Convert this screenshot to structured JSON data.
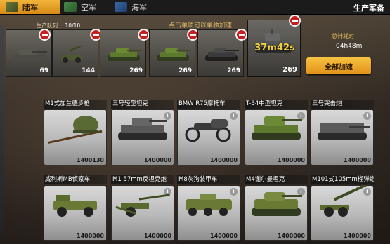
{
  "tabs": [
    {
      "label": "陆军",
      "active": true
    },
    {
      "label": "空军",
      "active": false
    },
    {
      "label": "海军",
      "active": false
    }
  ],
  "page_title": "生产军备",
  "queue": {
    "label": "生产队列:",
    "value": "10/10",
    "hint": "点击单项可以单独加速",
    "slots": [
      {
        "count": "69",
        "icon": "tank-destroyer-icon"
      },
      {
        "count": "144",
        "icon": "artillery-gun-icon"
      },
      {
        "count": "269",
        "icon": "green-tank-icon"
      },
      {
        "count": "269",
        "icon": "green-tank-icon"
      },
      {
        "count": "269",
        "icon": "dark-tank-icon"
      }
    ],
    "active": {
      "timer": "37m42s",
      "count": "269",
      "icon": "grey-tank-icon"
    },
    "total_label": "总计耗时",
    "total_value": "04h48m",
    "speedup_label": "全部加速"
  },
  "cards": [
    {
      "name": "M1式加兰德步枪",
      "cost": "1400130",
      "icon": "rifle-icon"
    },
    {
      "name": "三号轻型坦克",
      "cost": "1400000",
      "icon": "light-tank-icon"
    },
    {
      "name": "BMW R75摩托车",
      "cost": "1400000",
      "icon": "motorcycle-icon"
    },
    {
      "name": "T-34中型坦克",
      "cost": "1400000",
      "icon": "medium-tank-icon"
    },
    {
      "name": "三号突击炮",
      "cost": "1400000",
      "icon": "assault-gun-icon"
    },
    {
      "name": "威利斯MB侦察车",
      "cost": "1400000",
      "icon": "jeep-icon"
    },
    {
      "name": "M1 57mm反坦克炮",
      "cost": "1400000",
      "icon": "anti-tank-gun-icon"
    },
    {
      "name": "M8灰狗装甲车",
      "cost": "1400000",
      "icon": "armored-car-icon"
    },
    {
      "name": "M4谢尔曼坦克",
      "cost": "1400000",
      "icon": "sherman-tank-icon"
    },
    {
      "name": "M101式105mm榴弹炮",
      "cost": "1400000",
      "icon": "howitzer-icon"
    }
  ],
  "colors": {
    "accent": "#f2b43a",
    "remove": "#c61f1f",
    "timer": "#f4d33a"
  }
}
